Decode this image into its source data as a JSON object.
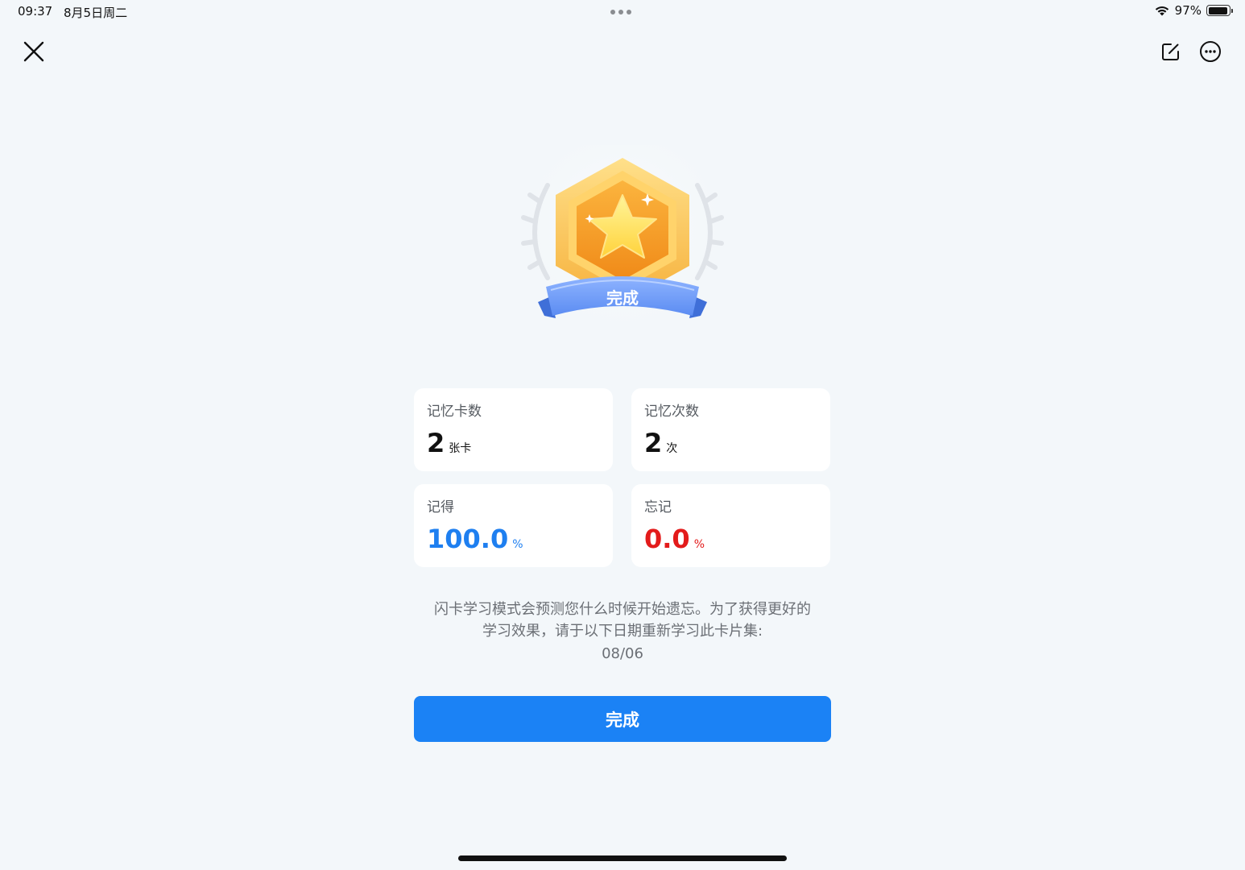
{
  "status_bar": {
    "time": "09:37",
    "date": "8月5日周二",
    "battery": "97%",
    "battery_level": 0.97
  },
  "header": {
    "close_icon": "close-icon",
    "edit_icon": "edit-icon",
    "more_icon": "more-icon"
  },
  "badge": {
    "label": "完成"
  },
  "stats": {
    "cards_memorized": {
      "label": "记忆卡数",
      "value": "2",
      "unit": "张卡"
    },
    "memory_count": {
      "label": "记忆次数",
      "value": "2",
      "unit": "次"
    },
    "remembered": {
      "label": "记得",
      "value": "100.0",
      "unit": "%"
    },
    "forgot": {
      "label": "忘记",
      "value": "0.0",
      "unit": "%"
    }
  },
  "hint": {
    "line1": "闪卡学习模式会预测您什么时候开始遗忘。为了获得更好的",
    "line2": "学习效果，请于以下日期重新学习此卡片集:",
    "date": "08/06"
  },
  "done_button": {
    "label": "完成"
  },
  "colors": {
    "accent": "#1b82f5",
    "remembered": "#1e7ff0",
    "forgot": "#e31b1b",
    "background": "#f3f7fa"
  }
}
